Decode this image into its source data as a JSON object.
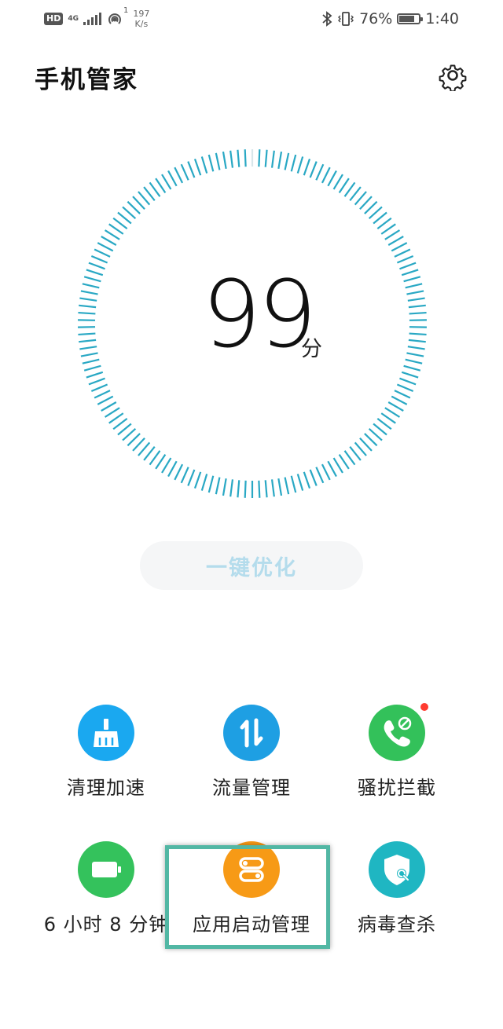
{
  "status_bar": {
    "hd": "HD",
    "network": "4G",
    "sim_slot": "1",
    "speed_value": "197",
    "speed_unit": "K/s",
    "battery_percent": "76%",
    "battery_level": 0.76,
    "time": "1:40"
  },
  "header": {
    "title": "手机管家",
    "settings_icon": "gear-icon"
  },
  "score": {
    "value": "99",
    "unit": "分"
  },
  "optimize_button": {
    "label": "一键优化"
  },
  "tools": [
    {
      "label": "清理加速",
      "icon": "broom-icon",
      "color": "#1aa8f0"
    },
    {
      "label": "流量管理",
      "icon": "transfer-arrows-icon",
      "color": "#1e9fe3"
    },
    {
      "label": "骚扰拦截",
      "icon": "phone-block-icon",
      "color": "#33c15a",
      "badge": true
    },
    {
      "label": "6 小时 8 分钟",
      "icon": "battery-icon",
      "color": "#34c25c"
    },
    {
      "label": "应用启动管理",
      "icon": "toggle-icon",
      "color": "#f79a16",
      "highlighted": true
    },
    {
      "label": "病毒查杀",
      "icon": "shield-search-icon",
      "color": "#1fb6c2"
    }
  ],
  "colors": {
    "ring": "#29a8c4",
    "highlight": "#52b7a4",
    "button_text": "#b4dcec"
  }
}
